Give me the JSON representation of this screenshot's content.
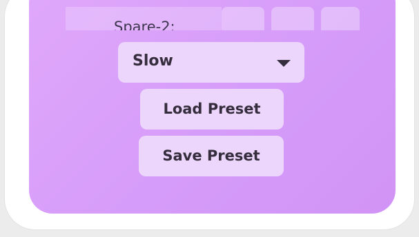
{
  "spare": {
    "label": "Spare-2:"
  },
  "speed_select": {
    "value": "Slow"
  },
  "buttons": {
    "load_preset": "Load Preset",
    "save_preset": "Save Preset"
  },
  "colors": {
    "panel": "#d89ef9",
    "control_bg": "#ecd6fb",
    "text": "#352d3d",
    "frame": "#ffffff"
  }
}
